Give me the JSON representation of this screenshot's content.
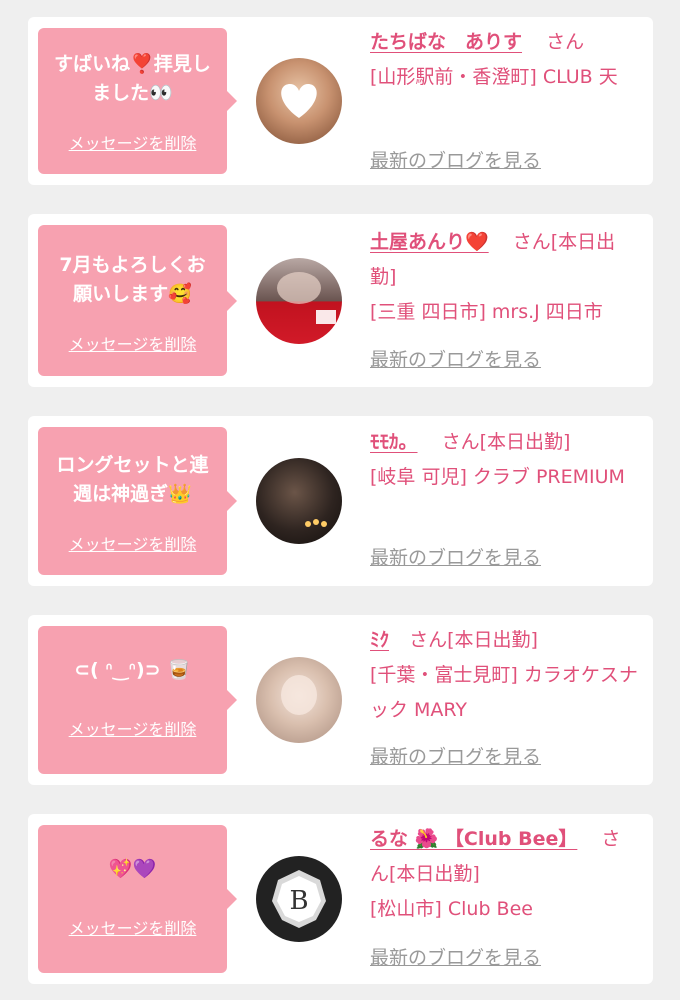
{
  "delete_label": "メッセージを削除",
  "blog_label": "最新のブログを見る",
  "items": [
    {
      "message": "すばいね❣️拝見し\nました👀",
      "name": "たちばな　ありす",
      "suffix": "さん",
      "shop": "[山形駅前・香澄町] CLUB 天"
    },
    {
      "message": "7月もよろしくお\n願いします🥰",
      "name": "土屋あんり❤️",
      "suffix": "さん[本日出勤]",
      "shop": "[三重 四日市] mrs.J 四日市"
    },
    {
      "message": "ロングセットと連\n週は神過ぎ👑",
      "name": "ﾓﾓｶ。",
      "suffix": "さん[本日出勤]",
      "shop": "[岐阜 可児] クラブ PREMIUM"
    },
    {
      "message": "⊂( ᐢ‿ᐢ)⊃ 🥃",
      "name": "ﾐｸ",
      "suffix": "さん[本日出勤]",
      "shop": "[千葉・富士見町] カラオケスナック MARY"
    },
    {
      "message": "💖💜",
      "name": "るな 🌺 【Club Bee】",
      "suffix": "さん[本日出勤]",
      "shop": "[松山市] Club Bee"
    }
  ],
  "colors": {
    "bubble": "#f7a1b0",
    "name": "#e0507a",
    "link_gray": "#999999",
    "page_bg": "#efefef"
  }
}
